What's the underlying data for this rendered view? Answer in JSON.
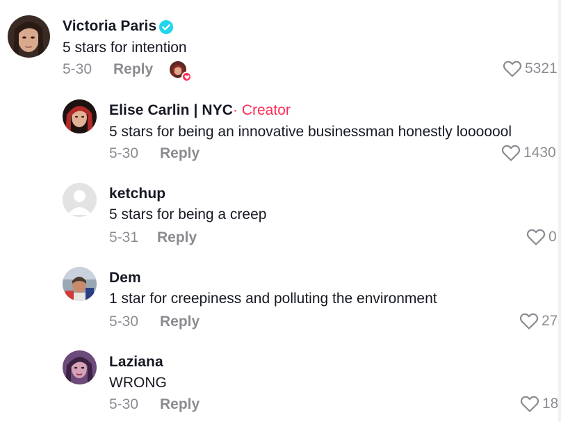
{
  "comments": [
    {
      "name": "Victoria Paris",
      "verified": true,
      "text": "5 stars for intention",
      "date": "5-30",
      "reply_label": "Reply",
      "likes": "5321",
      "liked_by_creator": true,
      "avatar_icon": "user-avatar-photo"
    },
    {
      "name": "Elise Carlin | NYC",
      "creator_tag": "· Creator",
      "text": "5 stars for being an innovative businessman honestly looooool",
      "date": "5-30",
      "reply_label": "Reply",
      "likes": "1430",
      "avatar_icon": "user-avatar-photo"
    },
    {
      "name": "ketchup",
      "text": "5 stars for being a creep",
      "date": "5-31",
      "reply_label": "Reply",
      "likes": "0",
      "avatar_icon": "default-avatar-icon"
    },
    {
      "name": "Dem",
      "text": "1 star for creepiness and polluting the environment",
      "date": "5-30",
      "reply_label": "Reply",
      "likes": "27",
      "avatar_icon": "user-avatar-photo"
    },
    {
      "name": "Laziana",
      "text": "WRONG",
      "date": "5-30",
      "reply_label": "Reply",
      "likes": "18",
      "avatar_icon": "user-avatar-photo"
    }
  ],
  "colors": {
    "creator_tag": "#fe2c55",
    "verified_badge": "#20d5ec",
    "muted_text": "#8a8b91"
  }
}
